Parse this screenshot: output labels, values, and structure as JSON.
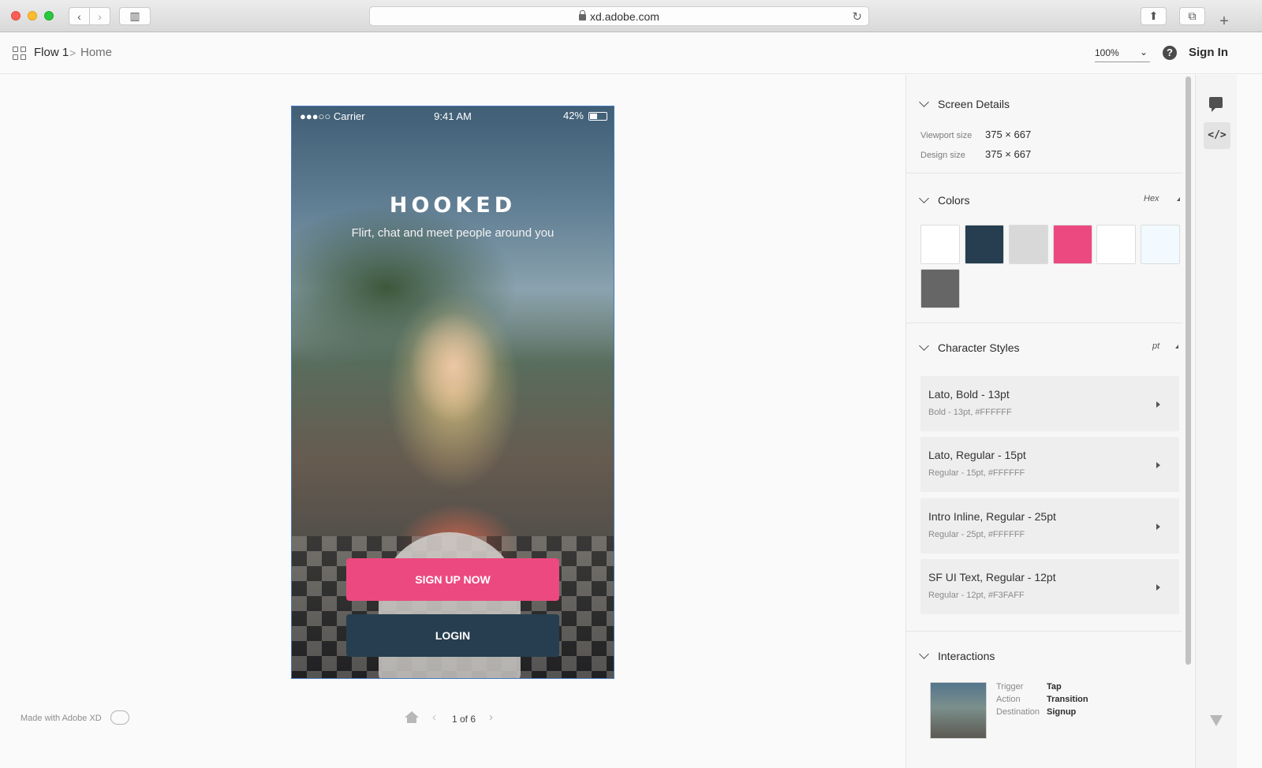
{
  "browser": {
    "url": "xd.adobe.com"
  },
  "header": {
    "breadcrumb_flow": "Flow 1",
    "breadcrumb_separator": ">",
    "breadcrumb_home": "Home",
    "zoom": "100%",
    "help_glyph": "?",
    "sign_in": "Sign In"
  },
  "artboard": {
    "status_signal": "●●●○○ Carrier",
    "status_time": "9:41 AM",
    "status_battery": "42%",
    "app_title": "HOOKED",
    "tagline": "Flirt, chat and meet people around you",
    "signup_label": "SIGN UP NOW",
    "login_label": "LOGIN"
  },
  "footer": {
    "made_with": "Made with Adobe XD",
    "pager_label": "1 of 6"
  },
  "panel": {
    "screen_details": {
      "title": "Screen Details",
      "viewport_label": "Viewport size",
      "viewport_value": "375 × 667",
      "design_label": "Design size",
      "design_value": "375 × 667"
    },
    "colors": {
      "title": "Colors",
      "unit": "Hex",
      "swatches": [
        "#FFFFFF",
        "#263E4F",
        "#D8D8D8",
        "#EC4980",
        "#FFFFFF",
        "#F3FAFF",
        "#666666"
      ]
    },
    "character_styles": {
      "title": "Character Styles",
      "unit": "pt",
      "items": [
        {
          "name": "Lato, Bold - 13pt",
          "desc": "Bold - 13pt, #FFFFFF"
        },
        {
          "name": "Lato, Regular - 15pt",
          "desc": "Regular - 15pt, #FFFFFF"
        },
        {
          "name": "Intro Inline, Regular - 25pt",
          "desc": "Regular - 25pt, #FFFFFF"
        },
        {
          "name": "SF UI Text, Regular - 12pt",
          "desc": "Regular - 12pt, #F3FAFF"
        }
      ]
    },
    "interactions": {
      "title": "Interactions",
      "trigger_label": "Trigger",
      "trigger_value": "Tap",
      "action_label": "Action",
      "action_value": "Transition",
      "destination_label": "Destination",
      "destination_value": "Signup"
    }
  },
  "icons": {
    "rail": [
      "comment-icon",
      "code-icon",
      "feedback-icon"
    ],
    "header": [
      "grid-icon",
      "help-icon"
    ],
    "pager": [
      "home-icon",
      "chevron-left-icon",
      "chevron-right-icon"
    ]
  }
}
